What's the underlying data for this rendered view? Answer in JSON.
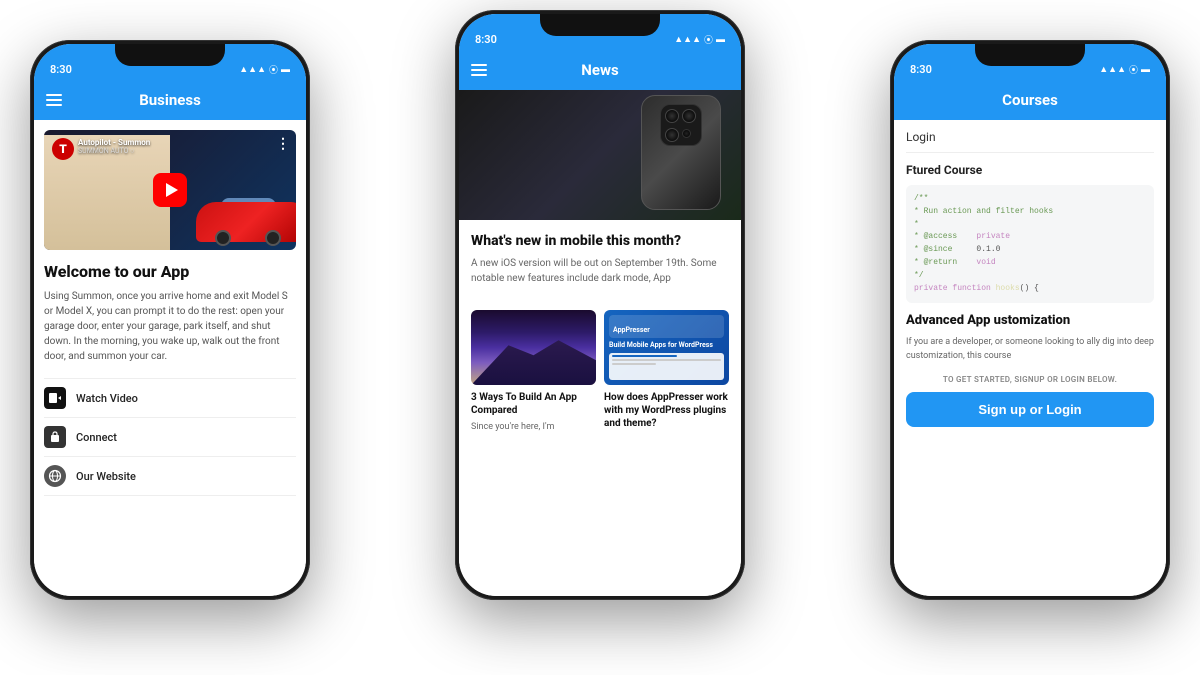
{
  "scene": {
    "background": "#ffffff"
  },
  "left_phone": {
    "status_time": "8:30",
    "nav_title": "Business",
    "video": {
      "title_line1": "Autopilot - Summon",
      "title_line2": "SUMMON AUTO ○"
    },
    "welcome_title": "Welcome to our App",
    "welcome_text": "Using Summon, once you arrive home and exit Model S or Model X, you can prompt it to do the rest: open your garage door, enter your garage, park itself, and shut down. In the morning, you wake up, walk out the front door, and summon your car.",
    "menu_items": [
      {
        "label": "Watch Video",
        "icon": "video"
      },
      {
        "label": "Connect",
        "icon": "bag"
      },
      {
        "label": "Our Website",
        "icon": "globe"
      }
    ]
  },
  "center_phone": {
    "status_time": "8:30",
    "nav_title": "News",
    "main_article": {
      "title": "What's new in mobile this month?",
      "text": "A new iOS version will be out on September 19th. Some notable new features include dark mode, App"
    },
    "card_left": {
      "title": "3 Ways To Build An App Compared",
      "text": "Since you're here, I'm"
    },
    "card_right": {
      "title": "How does AppPresser work with my WordPress plugins and theme?",
      "text": ""
    }
  },
  "right_phone": {
    "status_time": "8:30",
    "nav_title": "Courses",
    "login_label": "Login",
    "featured_label": "tured Course",
    "code_lines": [
      "/**",
      " * Run action and filter hooks",
      " *",
      " * @access    private",
      " * @since     0.1.0",
      " * @return    void",
      " */",
      "private function hooks() {"
    ],
    "course_title": "dvanced App ustomization",
    "course_desc": "you are a developer, or someone looking to ally dig into deep customization, this course",
    "signup_prompt": "O GET STARTED, SIGNUP OR LOGIN BELOW.",
    "signup_button": "Sign up or Login"
  }
}
